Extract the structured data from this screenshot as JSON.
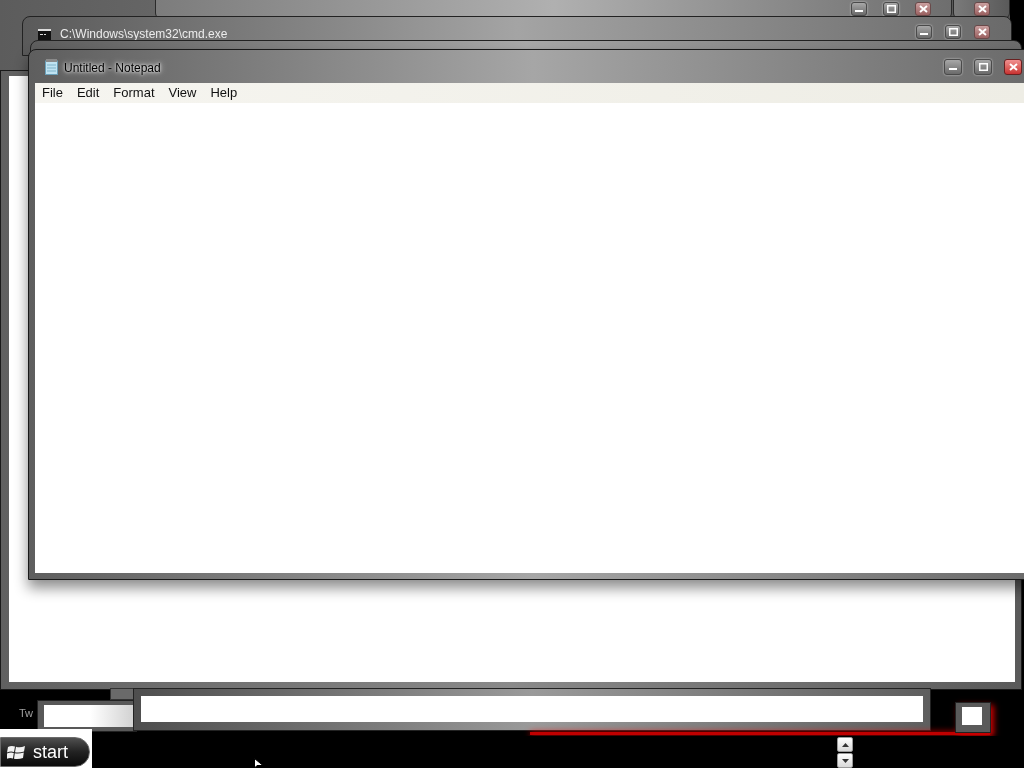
{
  "cmd_window": {
    "title": "C:\\Windows\\system32\\cmd.exe"
  },
  "notepad": {
    "title": "Untitled - Notepad",
    "menu": [
      "File",
      "Edit",
      "Format",
      "View",
      "Help"
    ]
  },
  "lower_window": {
    "title": "Tw"
  },
  "taskbar": {
    "start_label": "start"
  }
}
